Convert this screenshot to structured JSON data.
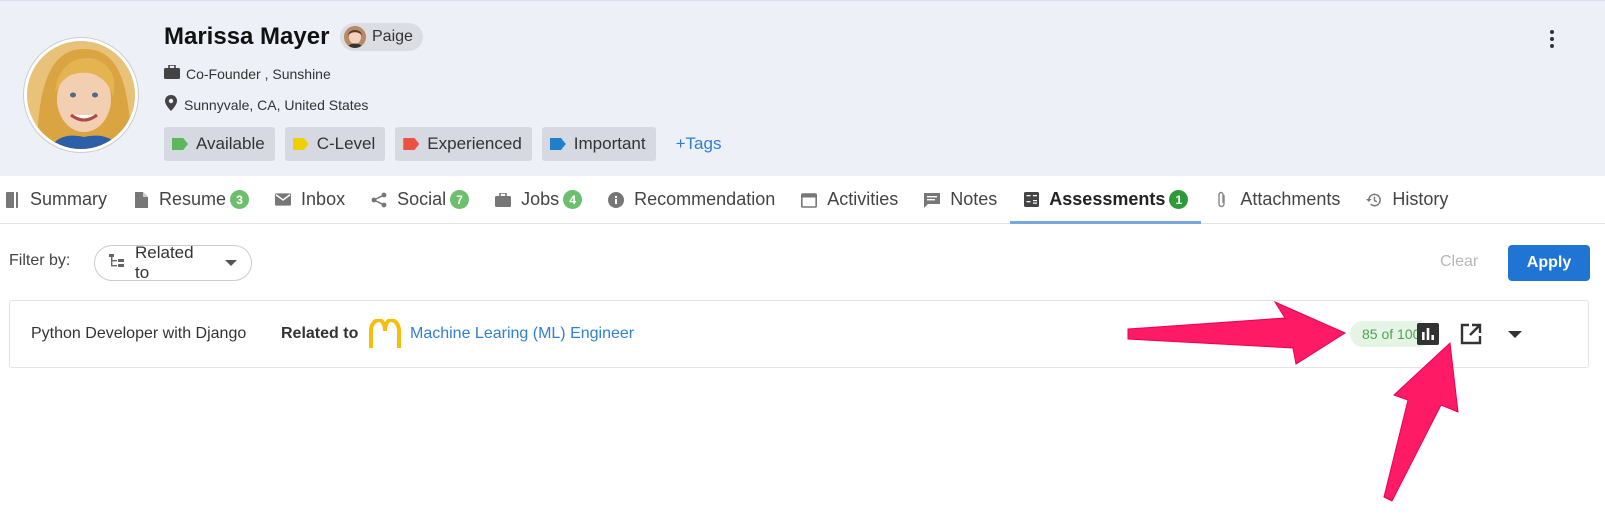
{
  "profile": {
    "name": "Marissa Mayer",
    "owner": "Paige",
    "job": "Co-Founder , Sunshine",
    "location": "Sunnyvale, CA, United States"
  },
  "tags": [
    {
      "label": "Available",
      "color": "#5cb85c"
    },
    {
      "label": "C-Level",
      "color": "#f0d000"
    },
    {
      "label": "Experienced",
      "color": "#e8543f"
    },
    {
      "label": "Important",
      "color": "#1f7fc8"
    }
  ],
  "add_tags_label": "+Tags",
  "tabs": [
    {
      "label": "Summary",
      "badge": ""
    },
    {
      "label": "Resume",
      "badge": "3"
    },
    {
      "label": "Inbox",
      "badge": ""
    },
    {
      "label": "Social",
      "badge": "7"
    },
    {
      "label": "Jobs",
      "badge": "4"
    },
    {
      "label": "Recommendation",
      "badge": ""
    },
    {
      "label": "Activities",
      "badge": ""
    },
    {
      "label": "Notes",
      "badge": ""
    },
    {
      "label": "Assessments",
      "badge": "1"
    },
    {
      "label": "Attachments",
      "badge": ""
    },
    {
      "label": "History",
      "badge": ""
    }
  ],
  "active_tab": "Assessments",
  "filter": {
    "label": "Filter by:",
    "selected": "Related to",
    "clear_label": "Clear",
    "apply_label": "Apply"
  },
  "assessment": {
    "title": "Python Developer with Django",
    "related_label": "Related to",
    "related_job": "Machine Learing (ML) Engineer",
    "score": "85 of 100"
  },
  "colors": {
    "accent": "#1f74d4",
    "annotation_arrow": "#ff1a66",
    "score_text": "#49a84f"
  }
}
